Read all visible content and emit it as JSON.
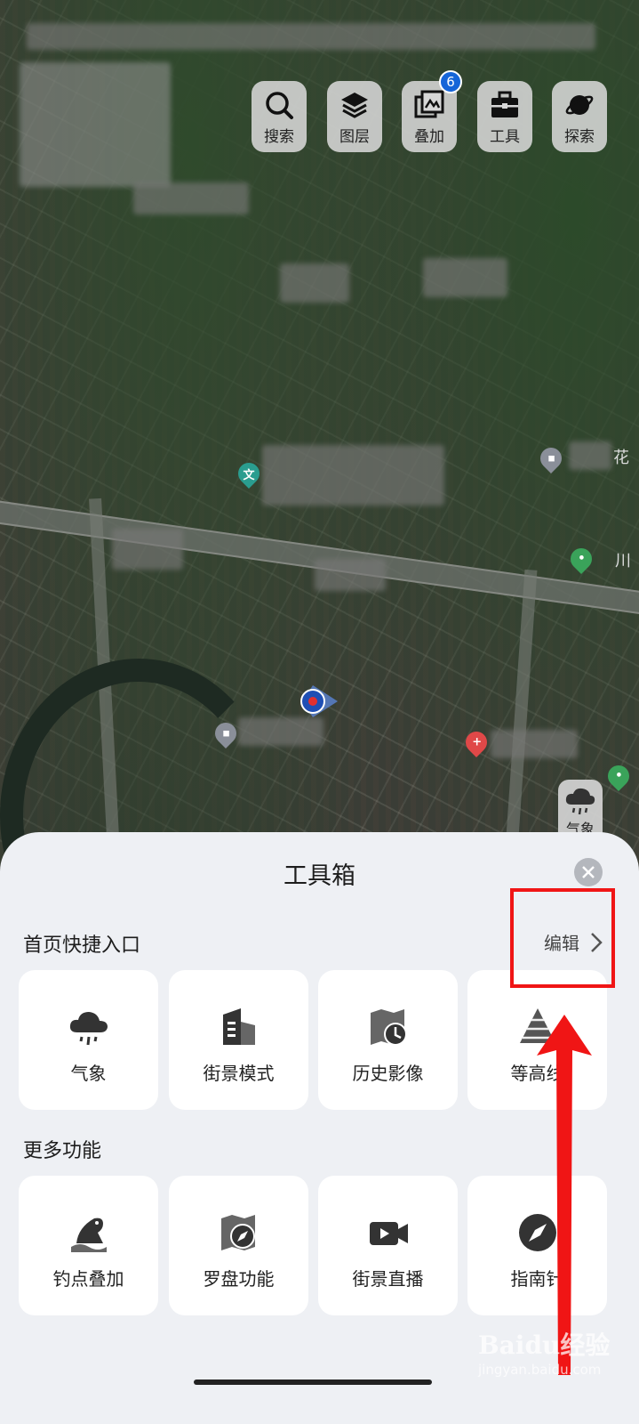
{
  "toolbar": {
    "buttons": [
      {
        "label": "搜索",
        "icon": "search-icon"
      },
      {
        "label": "图层",
        "icon": "layers-icon"
      },
      {
        "label": "叠加",
        "icon": "overlay-icon",
        "badge": "6"
      },
      {
        "label": "工具",
        "icon": "toolbox-icon"
      },
      {
        "label": "探索",
        "icon": "planet-icon"
      }
    ]
  },
  "map": {
    "poi_labels": {
      "culture": "文",
      "edge_label_1": "花",
      "edge_label_2": "川"
    },
    "weather_button_label": "气象"
  },
  "toolbox": {
    "title": "工具箱",
    "close_icon": "close-icon",
    "quick_entry": {
      "title": "首页快捷入口",
      "edit_label": "编辑",
      "items": [
        {
          "label": "气象",
          "icon": "weather-icon"
        },
        {
          "label": "街景模式",
          "icon": "building-icon"
        },
        {
          "label": "历史影像",
          "icon": "history-map-icon"
        },
        {
          "label": "等高线",
          "icon": "pyramid-icon"
        }
      ]
    },
    "more": {
      "title": "更多功能",
      "items": [
        {
          "label": "钓点叠加",
          "icon": "fishing-icon"
        },
        {
          "label": "罗盘功能",
          "icon": "compass-map-icon"
        },
        {
          "label": "街景直播",
          "icon": "video-camera-icon"
        },
        {
          "label": "指南针",
          "icon": "compass-icon"
        }
      ]
    }
  },
  "watermark": {
    "line1": "Baidu经验",
    "line2": "jingyan.baidu.com"
  },
  "colors": {
    "annotation": "#f01515",
    "badge": "#1565d8",
    "sheet_bg": "#eef0f4"
  }
}
